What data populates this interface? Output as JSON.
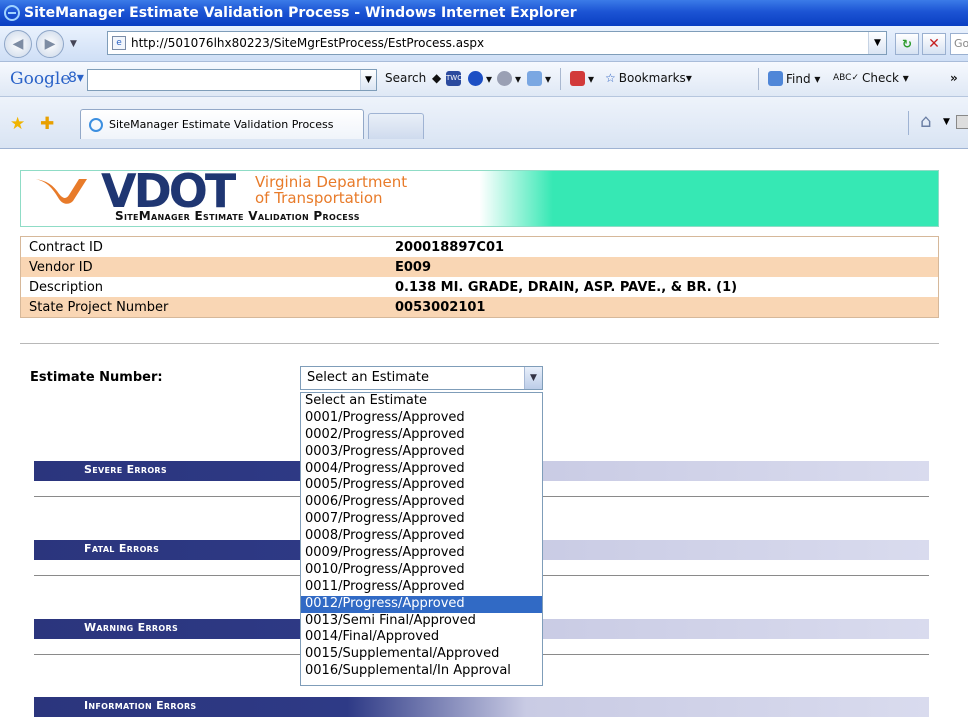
{
  "window": {
    "title": "SiteManager Estimate Validation Process - Windows Internet Explorer"
  },
  "address": {
    "url": "http://501076lhx80223/SiteMgrEstProcess/EstProcess.aspx",
    "search_partial": "Googl"
  },
  "google_toolbar": {
    "logo": "Google",
    "search_label": "Search",
    "bookmarks_label": "Bookmarks",
    "find_label": "Find",
    "check_label": "Check",
    "more": "»"
  },
  "tabs": {
    "active_label": "SiteManager Estimate Validation Process"
  },
  "header": {
    "logo_text": "VDOT",
    "dept_line1": "Virginia Department",
    "dept_line2": "of Transportation",
    "subtitle": "SiteManager Estimate Validation Process"
  },
  "info": [
    {
      "label": "Contract ID",
      "value": "200018897C01"
    },
    {
      "label": "Vendor ID",
      "value": "E009"
    },
    {
      "label": "Description",
      "value": "0.138 MI. GRADE, DRAIN, ASP. PAVE., & BR. (1)"
    },
    {
      "label": "State Project Number",
      "value": "0053002101"
    }
  ],
  "estimate": {
    "label": "Estimate Number:",
    "selected": "Select an Estimate",
    "options": [
      "Select an Estimate",
      "0001/Progress/Approved",
      "0002/Progress/Approved",
      "0003/Progress/Approved",
      "0004/Progress/Approved",
      "0005/Progress/Approved",
      "0006/Progress/Approved",
      "0007/Progress/Approved",
      "0008/Progress/Approved",
      "0009/Progress/Approved",
      "0010/Progress/Approved",
      "0011/Progress/Approved",
      "0012/Progress/Approved",
      "0013/Semi Final/Approved",
      "0014/Final/Approved",
      "0015/Supplemental/Approved",
      "0016/Supplemental/In Approval"
    ],
    "highlighted_index": 12
  },
  "sections": {
    "severe": "Severe Errors",
    "fatal": "Fatal Errors",
    "warning": "Warning Errors",
    "information": "Information Errors"
  }
}
